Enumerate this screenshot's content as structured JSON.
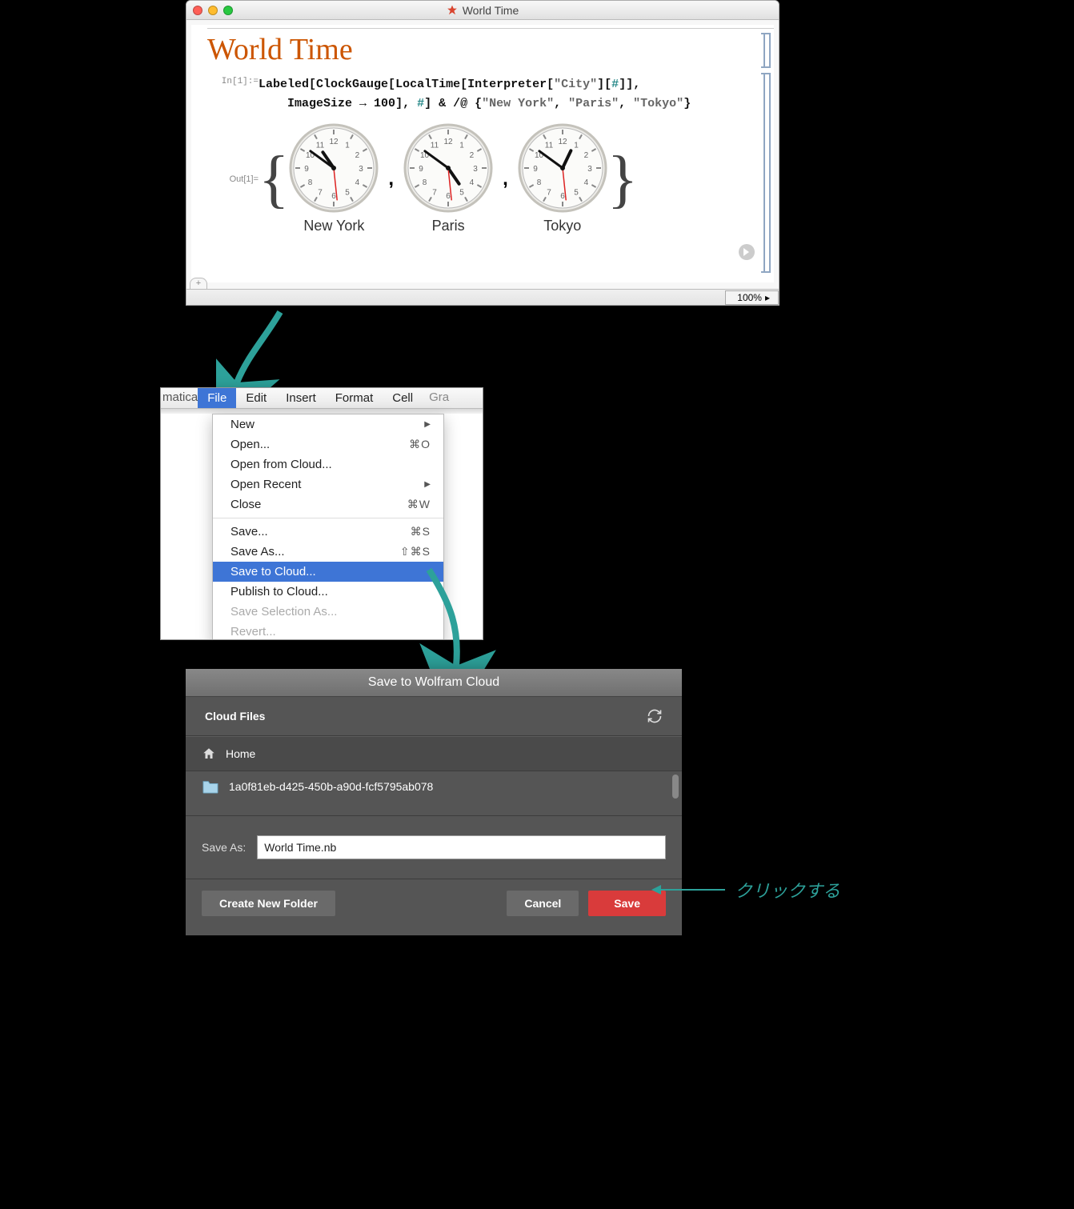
{
  "notebook": {
    "window_title": "World Time",
    "doc_title": "World Time",
    "in_label": "In[1]:=",
    "out_label": "Out[1]=",
    "code_line1_a": "Labeled",
    "code_line1_b": "ClockGauge",
    "code_line1_c": "LocalTime",
    "code_line1_d": "Interpreter",
    "code_line1_e": "\"City\"",
    "code_line1_slot": "#",
    "code_line2_a": "ImageSize",
    "code_line2_b": "100",
    "code_line2_slot": "#",
    "code_line2_c": "\"New York\"",
    "code_line2_d": "\"Paris\"",
    "code_line2_e": "\"Tokyo\"",
    "clocks": [
      {
        "label": "New York",
        "h": 10,
        "m": 51,
        "s": 29
      },
      {
        "label": "Paris",
        "h": 4,
        "m": 51,
        "s": 29
      },
      {
        "label": "Tokyo",
        "h": 12,
        "m": 51,
        "s": 29
      }
    ],
    "zoom": "100%"
  },
  "menubar": {
    "left_trunc": "matica",
    "items": [
      "File",
      "Edit",
      "Insert",
      "Format",
      "Cell"
    ],
    "right_trunc": "Gra",
    "active_index": 0,
    "dropdown": [
      {
        "label": "New",
        "shortcut": "",
        "submenu": true
      },
      {
        "label": "Open...",
        "shortcut": "⌘O"
      },
      {
        "label": "Open from Cloud..."
      },
      {
        "label": "Open Recent",
        "submenu": true
      },
      {
        "label": "Close",
        "shortcut": "⌘W"
      },
      {
        "sep": true
      },
      {
        "label": "Save...",
        "shortcut": "⌘S"
      },
      {
        "label": "Save As...",
        "shortcut": "⇧⌘S"
      },
      {
        "label": "Save to Cloud...",
        "selected": true
      },
      {
        "label": "Publish to Cloud..."
      },
      {
        "label": "Save Selection As...",
        "disabled": true
      },
      {
        "label": "Revert...",
        "disabled": true
      }
    ]
  },
  "dialog": {
    "title": "Save to Wolfram Cloud",
    "header": "Cloud Files",
    "breadcrumb": "Home",
    "list_item": "1a0f81eb-d425-450b-a90d-fcf5795ab078",
    "saveas_label": "Save As:",
    "saveas_value": "World Time.nb",
    "btn_newfolder": "Create New Folder",
    "btn_cancel": "Cancel",
    "btn_save": "Save"
  },
  "callout_text": "クリックする"
}
